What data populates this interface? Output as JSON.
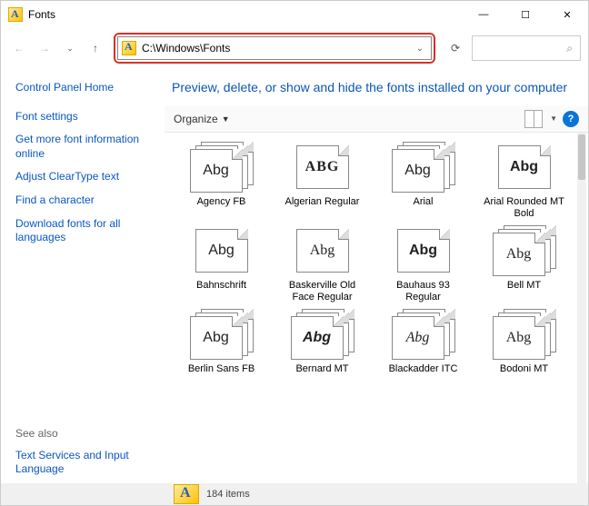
{
  "window": {
    "title": "Fonts"
  },
  "addressbar": {
    "path": "C:\\Windows\\Fonts"
  },
  "description": "Preview, delete, or show and hide the fonts installed on your computer",
  "toolbar": {
    "organize": "Organize"
  },
  "sidebar": {
    "home": "Control Panel Home",
    "links": [
      "Font settings",
      "Get more font information online",
      "Adjust ClearType text",
      "Find a character",
      "Download fonts for all languages"
    ],
    "see_also_label": "See also",
    "see_also_links": [
      "Text Services and Input Language"
    ]
  },
  "fonts": [
    {
      "name": "Agency FB",
      "sample": "Abg",
      "stack": true,
      "cls": "s-agency"
    },
    {
      "name": "Algerian Regular",
      "sample": "ABG",
      "stack": false,
      "cls": "s-algerian"
    },
    {
      "name": "Arial",
      "sample": "Abg",
      "stack": true,
      "cls": "s-arial"
    },
    {
      "name": "Arial Rounded MT Bold",
      "sample": "Abg",
      "stack": false,
      "cls": "s-arialrounded"
    },
    {
      "name": "Bahnschrift",
      "sample": "Abg",
      "stack": false,
      "cls": "s-bahnschrift"
    },
    {
      "name": "Baskerville Old Face Regular",
      "sample": "Abg",
      "stack": false,
      "cls": "s-baskerville"
    },
    {
      "name": "Bauhaus 93 Regular",
      "sample": "Abg",
      "stack": false,
      "cls": "s-bauhaus"
    },
    {
      "name": "Bell MT",
      "sample": "Abg",
      "stack": true,
      "cls": "s-bellmt"
    },
    {
      "name": "Berlin Sans FB",
      "sample": "Abg",
      "stack": true,
      "cls": "s-berlinsans"
    },
    {
      "name": "Bernard MT",
      "sample": "Abg",
      "stack": true,
      "cls": "s-bernard"
    },
    {
      "name": "Blackadder ITC",
      "sample": "Abg",
      "stack": true,
      "cls": "s-blackadder"
    },
    {
      "name": "Bodoni MT",
      "sample": "Abg",
      "stack": true,
      "cls": "s-bodoni"
    }
  ],
  "status": {
    "count_text": "184 items"
  }
}
